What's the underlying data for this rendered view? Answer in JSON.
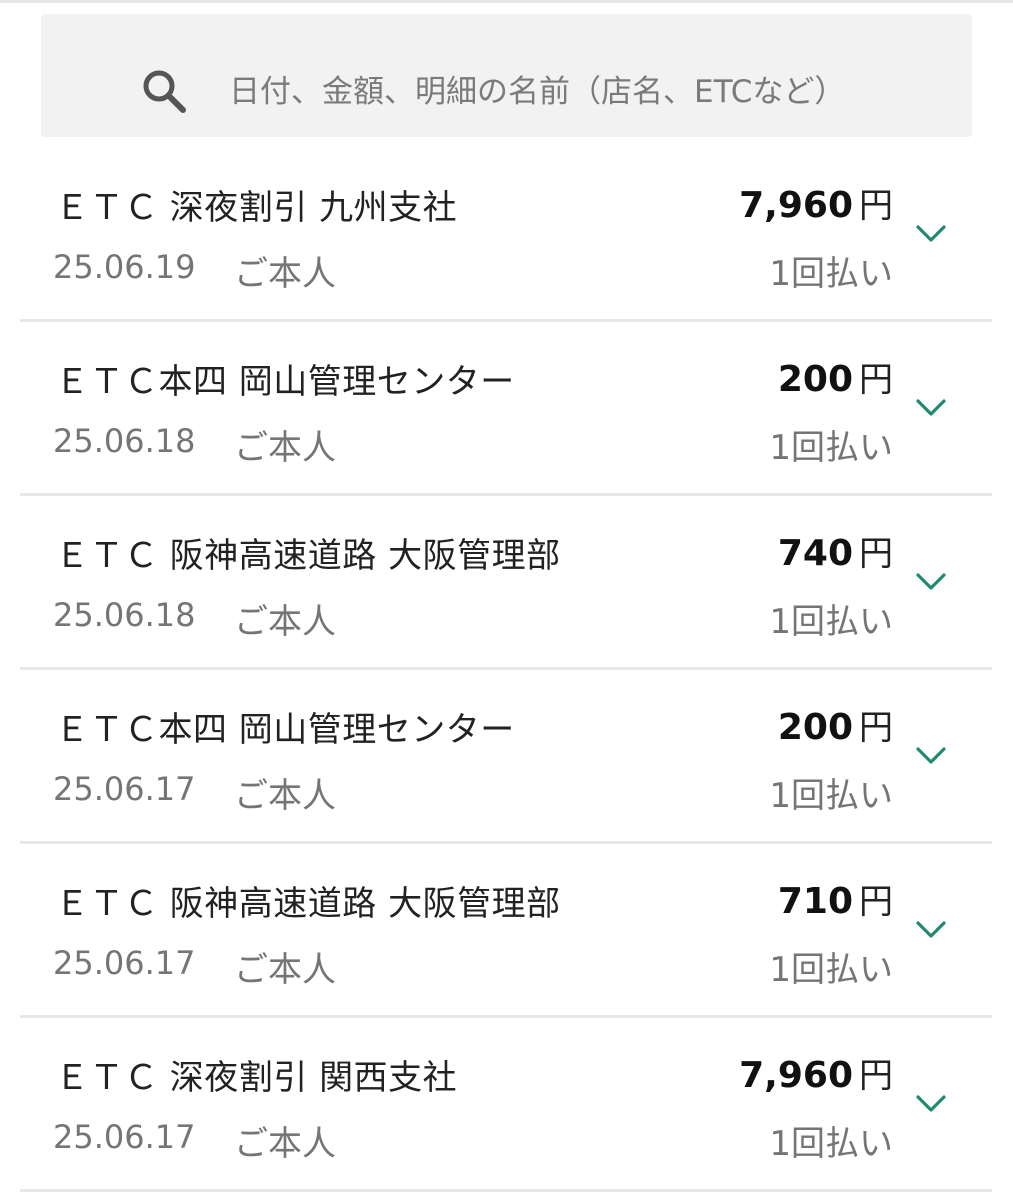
{
  "search": {
    "placeholder": "日付、金額、明細の名前（店名、ETCなど）",
    "icon": "search-icon"
  },
  "colors": {
    "accent": "#1f8a70",
    "search_bg": "#f2f2f2",
    "divider": "#e8e8e8",
    "muted_text": "#757575"
  },
  "transactions": [
    {
      "name": "ＥＴＣ 深夜割引 九州支社",
      "amount": "7,960",
      "currency": "円",
      "date": "25.06.19",
      "owner": "ご本人",
      "plan": "1回払い"
    },
    {
      "name": "ＥＴＣ本四 岡山管理センター",
      "amount": "200",
      "currency": "円",
      "date": "25.06.18",
      "owner": "ご本人",
      "plan": "1回払い"
    },
    {
      "name": "ＥＴＣ 阪神高速道路 大阪管理部",
      "amount": "740",
      "currency": "円",
      "date": "25.06.18",
      "owner": "ご本人",
      "plan": "1回払い"
    },
    {
      "name": "ＥＴＣ本四 岡山管理センター",
      "amount": "200",
      "currency": "円",
      "date": "25.06.17",
      "owner": "ご本人",
      "plan": "1回払い"
    },
    {
      "name": "ＥＴＣ 阪神高速道路 大阪管理部",
      "amount": "710",
      "currency": "円",
      "date": "25.06.17",
      "owner": "ご本人",
      "plan": "1回払い"
    },
    {
      "name": "ＥＴＣ 深夜割引 関西支社",
      "amount": "7,960",
      "currency": "円",
      "date": "25.06.17",
      "owner": "ご本人",
      "plan": "1回払い"
    }
  ]
}
